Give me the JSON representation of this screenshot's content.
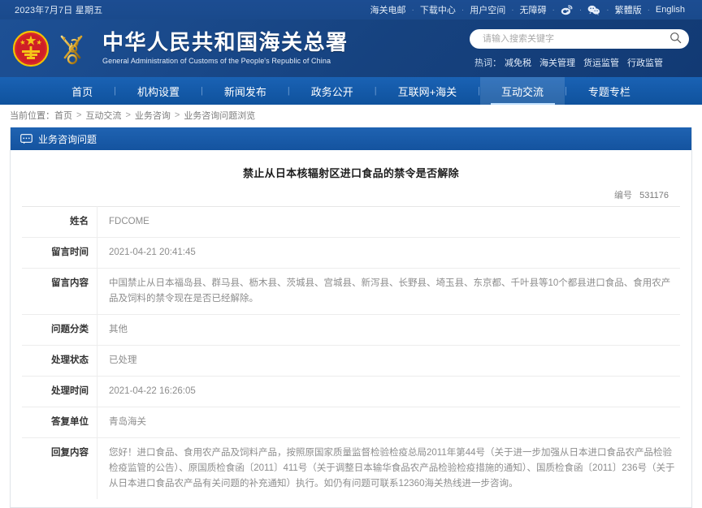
{
  "topbar": {
    "date": "2023年7月7日 星期五",
    "links": [
      {
        "label": "海关电邮",
        "name": "top-link-customs-mail"
      },
      {
        "label": "下载中心",
        "name": "top-link-download-center"
      },
      {
        "label": "用户空间",
        "name": "top-link-user-space"
      },
      {
        "label": "无障碍",
        "name": "top-link-accessibility"
      }
    ],
    "social": [
      {
        "icon": "weibo-icon",
        "name": "weibo-icon"
      },
      {
        "icon": "wechat-icon",
        "name": "wechat-icon"
      }
    ],
    "lang_links": [
      {
        "label": "繁體版",
        "name": "top-link-traditional-chinese"
      },
      {
        "label": "English",
        "name": "top-link-english"
      }
    ],
    "separator": "·"
  },
  "header": {
    "title_cn": "中华人民共和国海关总署",
    "title_en": "General Administration of Customs of the People's Republic of China",
    "emblem_icon": "national-emblem-icon",
    "customs_icon": "customs-caduceus-icon"
  },
  "search": {
    "placeholder": "请输入搜索关键字",
    "value": "",
    "icon": "search-icon",
    "hot_label": "热词：",
    "hot_words": [
      "减免税",
      "海关管理",
      "货运监管",
      "行政监管"
    ]
  },
  "nav": {
    "items": [
      {
        "label": "首页",
        "name": "nav-home",
        "active": false
      },
      {
        "label": "机构设置",
        "name": "nav-organization",
        "active": false
      },
      {
        "label": "新闻发布",
        "name": "nav-news",
        "active": false
      },
      {
        "label": "政务公开",
        "name": "nav-government-affairs",
        "active": false
      },
      {
        "label": "互联网+海关",
        "name": "nav-internet-customs",
        "active": false
      },
      {
        "label": "互动交流",
        "name": "nav-interaction",
        "active": true
      },
      {
        "label": "专题专栏",
        "name": "nav-special-columns",
        "active": false
      }
    ],
    "separator": "|"
  },
  "breadcrumb": {
    "prefix": "当前位置：",
    "items": [
      "首页",
      "互动交流",
      "业务咨询",
      "业务咨询问题浏览"
    ],
    "separator": ">"
  },
  "card": {
    "header_title": "业务咨询问题",
    "header_icon": "chat-bubble-icon",
    "question_title": "禁止从日本核辐射区进口食品的禁令是否解除",
    "number_label": "编号",
    "number_value": "531176",
    "rows": [
      {
        "label": "姓名",
        "value": "FDCOME",
        "name": "row-name"
      },
      {
        "label": "留言时间",
        "value": "2021-04-21 20:41:45",
        "name": "row-message-time"
      },
      {
        "label": "留言内容",
        "value": "中国禁止从日本福岛县、群马县、枥木县、茨城县、宫城县、新泻县、长野县、埼玉县、东京都、千叶县等10个都县进口食品、食用农产品及饲料的禁令现在是否已经解除。",
        "name": "row-message-content"
      },
      {
        "label": "问题分类",
        "value": "其他",
        "name": "row-question-category"
      },
      {
        "label": "处理状态",
        "value": "已处理",
        "name": "row-process-status"
      },
      {
        "label": "处理时间",
        "value": "2021-04-22 16:26:05",
        "name": "row-process-time"
      },
      {
        "label": "答复单位",
        "value": "青岛海关",
        "name": "row-reply-unit"
      },
      {
        "label": "回复内容",
        "value": "您好！进口食品、食用农产品及饲料产品，按照原国家质量监督检验检疫总局2011年第44号（关于进一步加强从日本进口食品农产品检验检疫监管的公告）、原国质检食函〔2011〕411号（关于调整日本输华食品农产品检验检疫措施的通知）、国质检食函〔2011〕236号（关于从日本进口食品农产品有关问题的补充通知）执行。如仍有问题可联系12360海关热线进一步咨询。",
        "name": "row-reply-content"
      }
    ]
  },
  "colors": {
    "top_bar": "#1b4b8f",
    "header": "#1a4a8c",
    "nav": "#1257a5",
    "card_header": "#1a5ba8"
  }
}
